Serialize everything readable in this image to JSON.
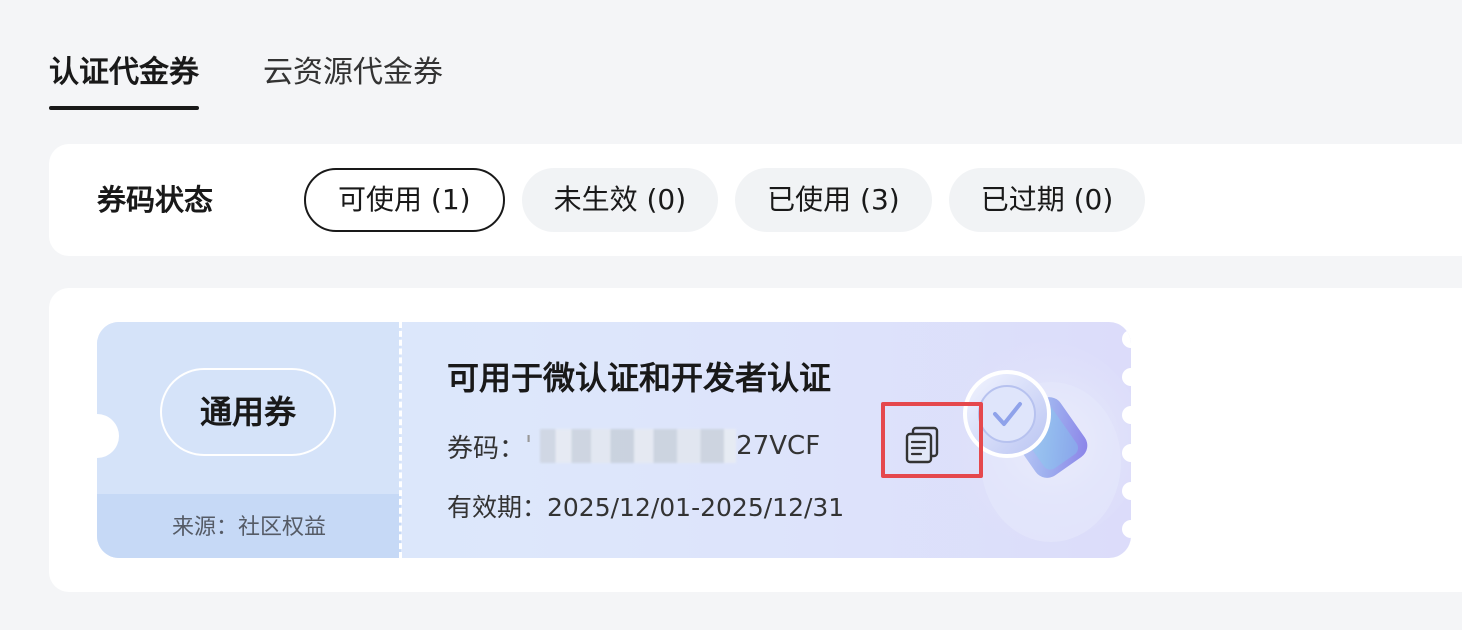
{
  "tabs": [
    {
      "label": "认证代金券",
      "active": true
    },
    {
      "label": "云资源代金券",
      "active": false
    }
  ],
  "filter": {
    "label": "券码状态",
    "chips": [
      {
        "label": "可使用 (1)",
        "selected": true
      },
      {
        "label": "未生效 (0)",
        "selected": false
      },
      {
        "label": "已使用 (3)",
        "selected": false
      },
      {
        "label": "已过期 (0)",
        "selected": false
      }
    ]
  },
  "coupon": {
    "type_label": "通用券",
    "source": "来源：社区权益",
    "title": "可用于微认证和开发者认证",
    "code_label": "券码：",
    "code_visible_prefix": "'",
    "code_visible_tail": "27VCF",
    "copy_icon": "copy-icon",
    "validity": "有效期：2025/12/01-2025/12/31"
  },
  "colors": {
    "page_bg": "#f4f5f7",
    "card_bg": "#ffffff",
    "coupon_bg": "#dde7fb",
    "coupon_left_bg": "#d5e3f9",
    "highlight_border": "#e5484d",
    "text_primary": "#191919"
  }
}
